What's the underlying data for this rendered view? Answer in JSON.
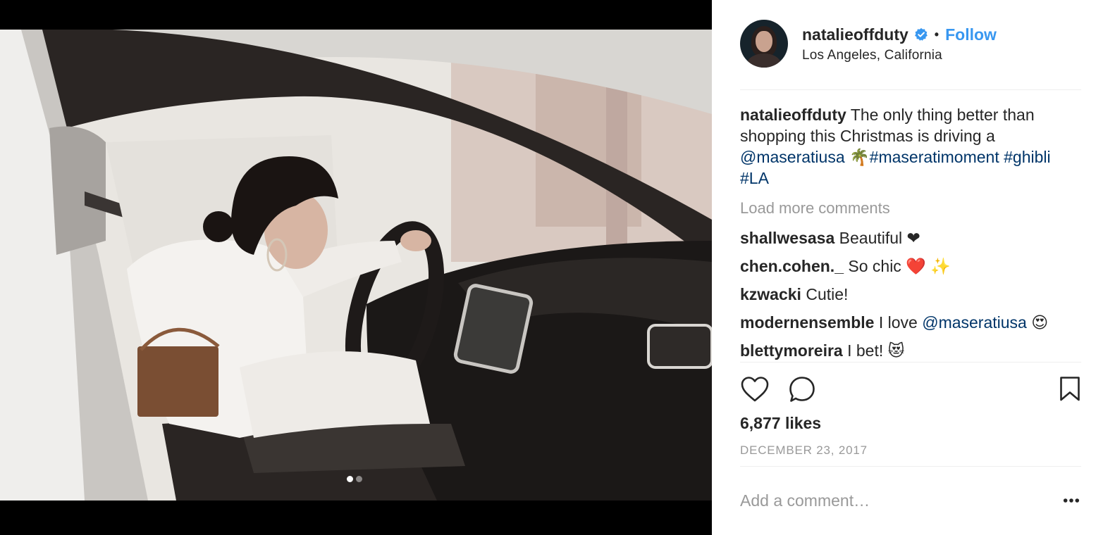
{
  "post": {
    "username": "natalieoffduty",
    "verified": true,
    "separator": "•",
    "follow_label": "Follow",
    "location": "Los Angeles, California",
    "caption": {
      "username": "natalieoffduty",
      "text": "The only thing better than shopping this Christmas is driving a",
      "mention": "@maseratiusa",
      "emoji": "🌴",
      "hashtags": [
        "#maseratimoment",
        "#ghibli",
        "#LA"
      ]
    },
    "load_more_label": "Load more comments",
    "comments": [
      {
        "username": "shallwesasa",
        "text": "Beautiful ❤"
      },
      {
        "username": "chen.cohen._",
        "text": "So chic ❤️ ✨"
      },
      {
        "username": "kzwacki",
        "text": "Cutie!"
      },
      {
        "username": "modernensemble",
        "text": "I love",
        "mention": "@maseratiusa",
        "emoji": "😍"
      },
      {
        "username": "blettymoreira",
        "text": "I bet! 😻"
      }
    ],
    "likes_label": "6,877 likes",
    "date_label": "DECEMBER 23, 2017",
    "add_comment_placeholder": "Add a comment…",
    "carousel": {
      "count": 2,
      "active_index": 0
    }
  },
  "icons": {
    "like": "heart-icon",
    "comment": "comment-bubble-icon",
    "save": "bookmark-icon",
    "more": "more-options-icon",
    "verified": "verified-badge-icon"
  },
  "colors": {
    "link_blue": "#3897f0",
    "mention_blue": "#003569",
    "muted_gray": "#999999",
    "text": "#262626"
  }
}
